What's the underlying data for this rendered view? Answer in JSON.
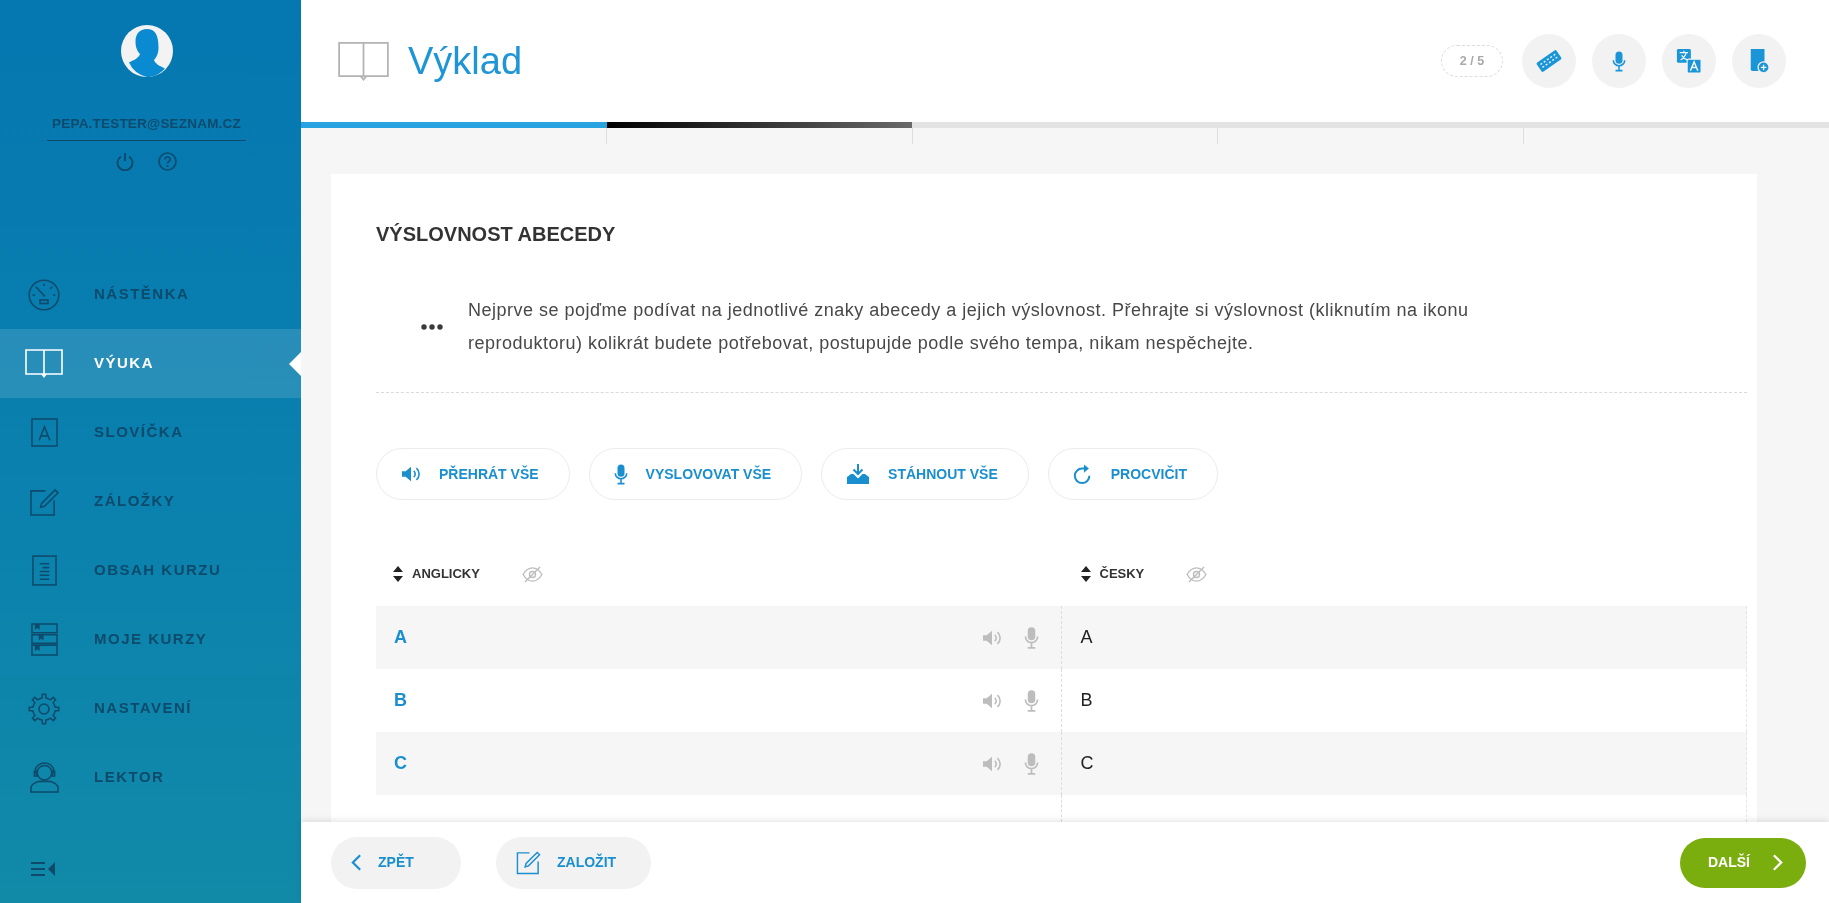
{
  "sidebar": {
    "user_email": "PEPA.TESTER@SEZNAM.CZ",
    "menu": [
      {
        "label": "NÁSTĚNKA",
        "selected": false
      },
      {
        "label": "VÝUKA",
        "selected": true
      },
      {
        "label": "SLOVÍČKA",
        "selected": false
      },
      {
        "label": "ZÁLOŽKY",
        "selected": false
      },
      {
        "label": "OBSAH KURZU",
        "selected": false
      },
      {
        "label": "MOJE KURZY",
        "selected": false
      },
      {
        "label": "NASTAVENÍ",
        "selected": false
      },
      {
        "label": "LEKTOR",
        "selected": false
      }
    ]
  },
  "header": {
    "title": "Výklad",
    "page_counter": "2 / 5"
  },
  "progress": {
    "steps": [
      {
        "completed": true,
        "current": false
      },
      {
        "completed": false,
        "current": true
      },
      {
        "completed": false,
        "current": false
      },
      {
        "completed": false,
        "current": false
      },
      {
        "completed": false,
        "current": false
      }
    ]
  },
  "lesson": {
    "heading": "VÝSLOVNOST ABECEDY",
    "intro": "Nejprve se pojďme podívat na jednotlivé znaky abecedy a jejich výslovnost. Přehrajte si výslovnost (kliknutím na ikonu reproduktoru) kolikrát budete potřebovat, postupujde podle svého tempa, nikam nespěchejte.",
    "actions": [
      {
        "label": "PŘEHRÁT VŠE"
      },
      {
        "label": "VYSLOVOVAT VŠE"
      },
      {
        "label": "STÁHNOUT VŠE"
      },
      {
        "label": "PROCVIČIT"
      }
    ],
    "table": {
      "columns": [
        {
          "label": "ANGLICKY"
        },
        {
          "label": "ČESKY"
        }
      ],
      "rows": [
        {
          "english": "A",
          "czech": "A"
        },
        {
          "english": "B",
          "czech": "B"
        },
        {
          "english": "C",
          "czech": "C"
        }
      ]
    }
  },
  "footer": {
    "back_label": "ZPĚT",
    "bookmark_label": "ZALOŽIT",
    "next_label": "DALŠÍ"
  }
}
